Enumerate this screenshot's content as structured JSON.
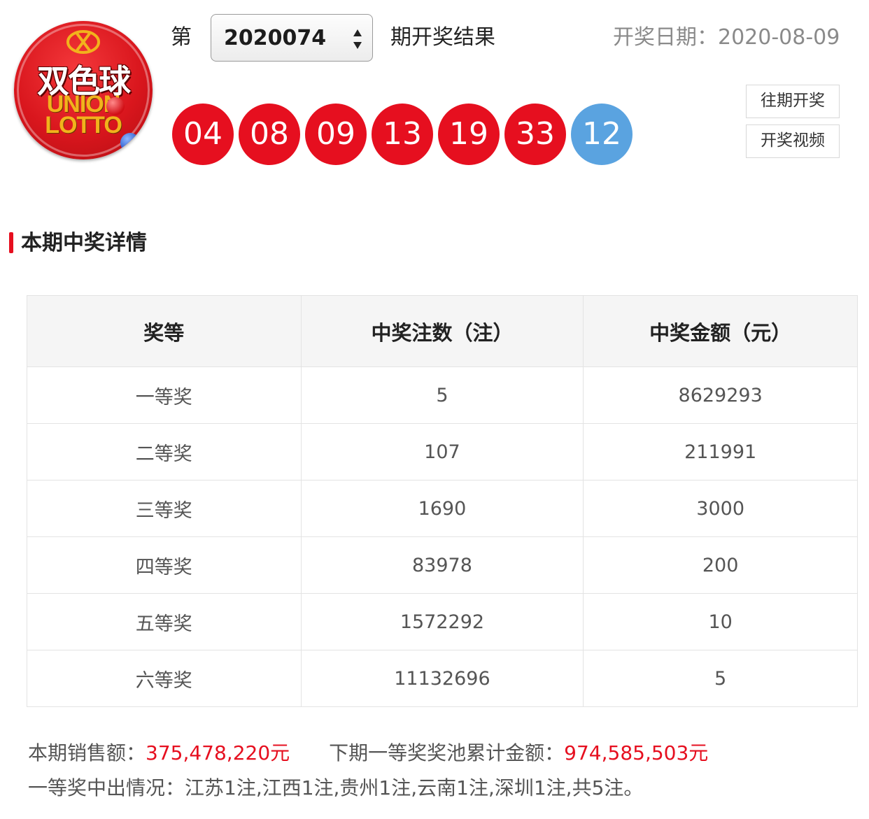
{
  "logo": {
    "cn_text": "双色球",
    "en_line1": "UNION",
    "en_line2": "LOTTO"
  },
  "header": {
    "issue_prefix": "第",
    "issue_selected": "2020074",
    "issue_suffix": "期开奖结果",
    "draw_date": "开奖日期：2020-08-09"
  },
  "balls": {
    "red": [
      "04",
      "08",
      "09",
      "13",
      "19",
      "33"
    ],
    "blue": "12",
    "red_color": "#e60f1f",
    "blue_color": "#5aa3e0"
  },
  "buttons": {
    "history": "往期开奖",
    "video": "开奖视频"
  },
  "section": {
    "title": "本期中奖详情"
  },
  "table": {
    "headers": [
      "奖等",
      "中奖注数（注）",
      "中奖金额（元）"
    ],
    "rows": [
      [
        "一等奖",
        "5",
        "8629293"
      ],
      [
        "二等奖",
        "107",
        "211991"
      ],
      [
        "三等奖",
        "1690",
        "3000"
      ],
      [
        "四等奖",
        "83978",
        "200"
      ],
      [
        "五等奖",
        "1572292",
        "10"
      ],
      [
        "六等奖",
        "11132696",
        "5"
      ]
    ]
  },
  "footer": {
    "sales_label": "本期销售额：",
    "sales_value": "375,478,220元",
    "pool_label": "下期一等奖奖池累计金额：",
    "pool_value": "974,585,503元",
    "first_prize_distribution": "一等奖中出情况：江苏1注,江西1注,贵州1注,云南1注,深圳1注,共5注。"
  }
}
